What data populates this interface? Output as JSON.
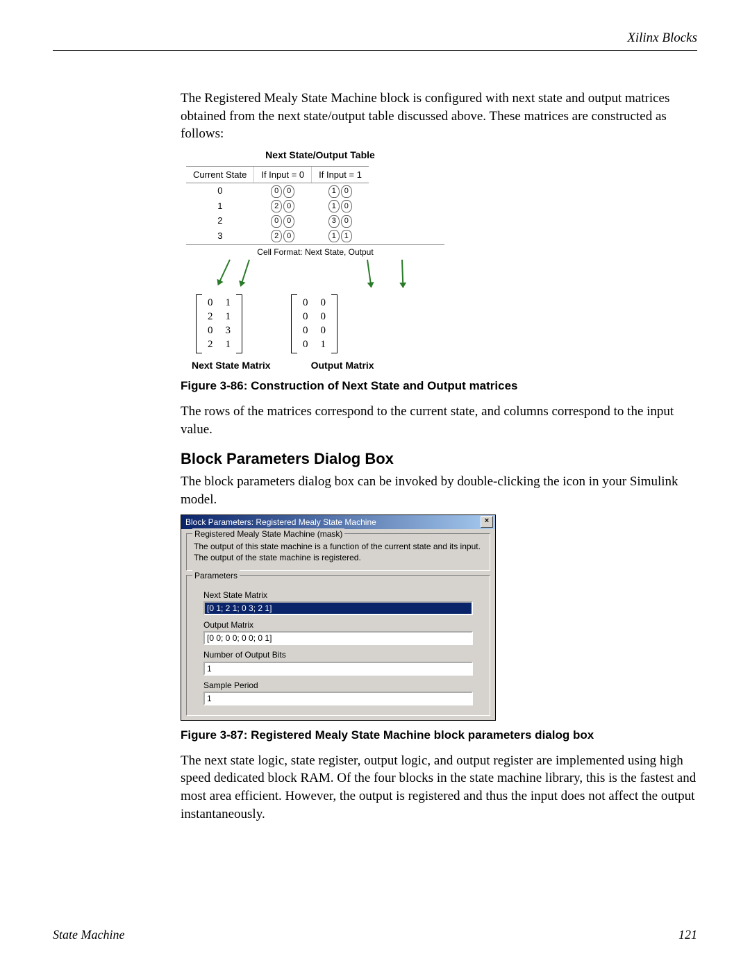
{
  "header": {
    "section_title": "Xilinx Blocks"
  },
  "intro_para": "The Registered Mealy State Machine block is configured with next state and output matrices obtained from the next state/output table discussed above.  These matrices are constructed as follows:",
  "figure1": {
    "title": "Next State/Output Table",
    "header_cells": [
      "Current State",
      "If Input = 0",
      "If Input = 1"
    ],
    "states": [
      "0",
      "1",
      "2",
      "3"
    ],
    "col_input0": [
      [
        "0",
        "0"
      ],
      [
        "2",
        "0"
      ],
      [
        "0",
        "0"
      ],
      [
        "2",
        "0"
      ]
    ],
    "col_input1": [
      [
        "1",
        "0"
      ],
      [
        "1",
        "0"
      ],
      [
        "3",
        "0"
      ],
      [
        "1",
        "1"
      ]
    ],
    "cell_format_label": "Cell Format: Next State, Output",
    "next_state_matrix": [
      [
        "0",
        "1"
      ],
      [
        "2",
        "1"
      ],
      [
        "0",
        "3"
      ],
      [
        "2",
        "1"
      ]
    ],
    "output_matrix": [
      [
        "0",
        "0"
      ],
      [
        "0",
        "0"
      ],
      [
        "0",
        "0"
      ],
      [
        "0",
        "1"
      ]
    ],
    "ns_caption": "Next State Matrix",
    "out_caption": "Output Matrix",
    "caption": "Figure 3-86:   Construction of Next State and Output matrices"
  },
  "mid_para": "The rows of the matrices correspond to the current state, and columns correspond to the input value.",
  "heading": "Block Parameters Dialog Box",
  "heading_para": "The block parameters dialog box can be invoked by double-clicking the icon in your Simulink model.",
  "dialog": {
    "title": "Block Parameters: Registered Mealy State Machine",
    "close_glyph": "×",
    "mask_group_title": "Registered Mealy State Machine (mask)",
    "mask_desc": "The output of this state machine is a function of the current state and its input.  The output of the state machine is registered.",
    "params_group_title": "Parameters",
    "fields": {
      "next_state": {
        "label": "Next State Matrix",
        "value": "[0 1; 2 1; 0 3; 2 1]"
      },
      "output": {
        "label": "Output Matrix",
        "value": "[0 0; 0 0; 0 0; 0 1]"
      },
      "bits": {
        "label": "Number of Output Bits",
        "value": "1"
      },
      "sample": {
        "label": "Sample Period",
        "value": "1"
      }
    }
  },
  "figure2_caption": "Figure 3-87:   Registered Mealy State Machine block parameters dialog box",
  "tail_para": "The next state logic, state register, output logic, and output register are implemented using high speed dedicated block RAM.  Of the four blocks in the state machine library, this is the fastest and most area efficient. However, the output is registered and thus the input does not affect the output instantaneously.",
  "footer": {
    "left": "State Machine",
    "right": "121"
  }
}
